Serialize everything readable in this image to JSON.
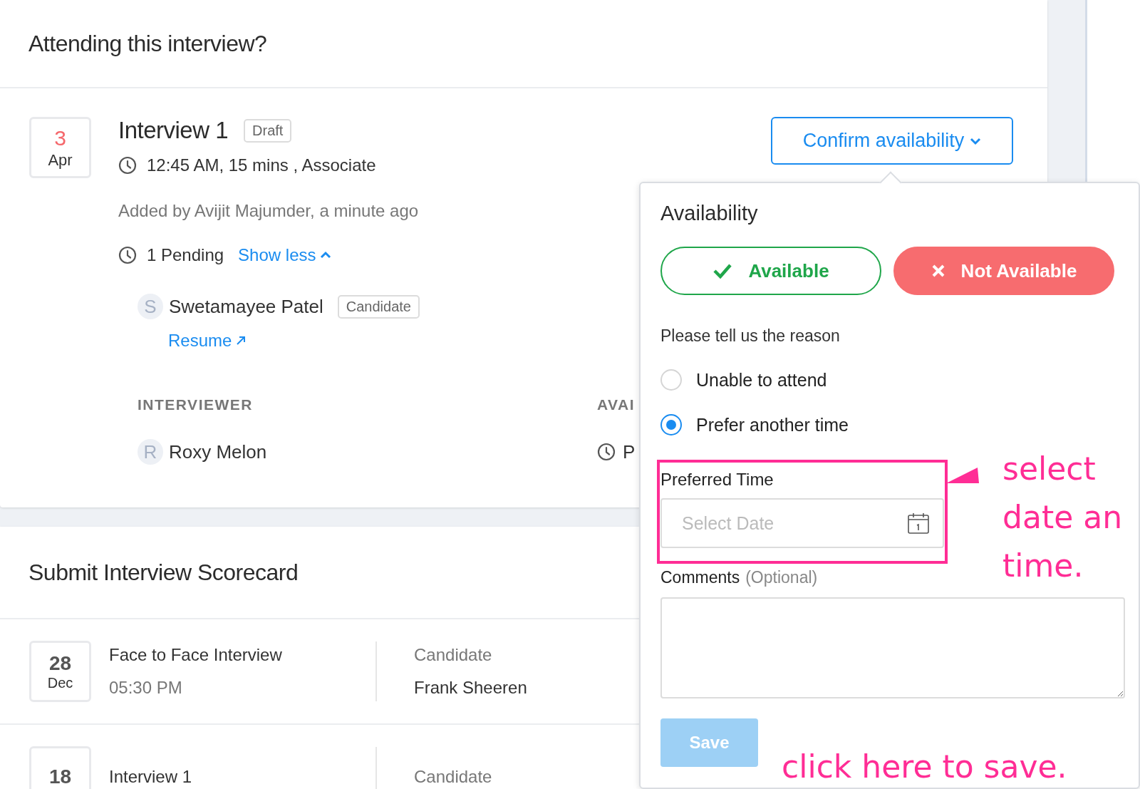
{
  "attending": {
    "title": "Attending this interview?",
    "interview": {
      "day": "3",
      "month": "Apr",
      "title": "Interview 1",
      "status": "Draft",
      "details": "12:45 AM, 15 mins , Associate",
      "added_by": "Added by Avijit Majumder, a minute ago",
      "pending": "1 Pending",
      "toggle": "Show less",
      "expanded": true,
      "candidate": {
        "initial": "S",
        "name": "Swetamayee Patel",
        "role": "Candidate",
        "link": "Resume"
      },
      "columns": [
        "INTERVIEWER",
        "AVAI"
      ],
      "interviewers": [
        {
          "initial": "R",
          "name": "Roxy Melon",
          "availability": "P"
        }
      ]
    },
    "confirm_button": "Confirm availability"
  },
  "availability_popover": {
    "title": "Availability",
    "options": [
      {
        "label": "Available",
        "kind": "available",
        "selected": false
      },
      {
        "label": "Not Available",
        "kind": "unavailable",
        "selected": true
      }
    ],
    "reason_prompt": "Please tell us the reason",
    "reasons": [
      {
        "label": "Unable to attend",
        "selected": false
      },
      {
        "label": "Prefer another time",
        "selected": true
      }
    ],
    "preferred_time": {
      "label": "Preferred Time",
      "placeholder": "Select Date"
    },
    "comments": {
      "label": "Comments",
      "hint": "(Optional)"
    },
    "save": {
      "label": "Save",
      "disabled": true
    }
  },
  "scorecard": {
    "title": "Submit Interview Scorecard",
    "rows": [
      {
        "day": "28",
        "month": "Dec",
        "title": "Face to Face Interview",
        "time": "05:30 PM",
        "label": "Candidate",
        "name": "Frank Sheeren"
      },
      {
        "day": "18",
        "title": "Interview 1",
        "label": "Candidate"
      }
    ]
  },
  "annotations": [
    {
      "lines": [
        "select",
        "date an",
        "time."
      ]
    },
    {
      "lines": [
        "click here to save."
      ]
    }
  ]
}
